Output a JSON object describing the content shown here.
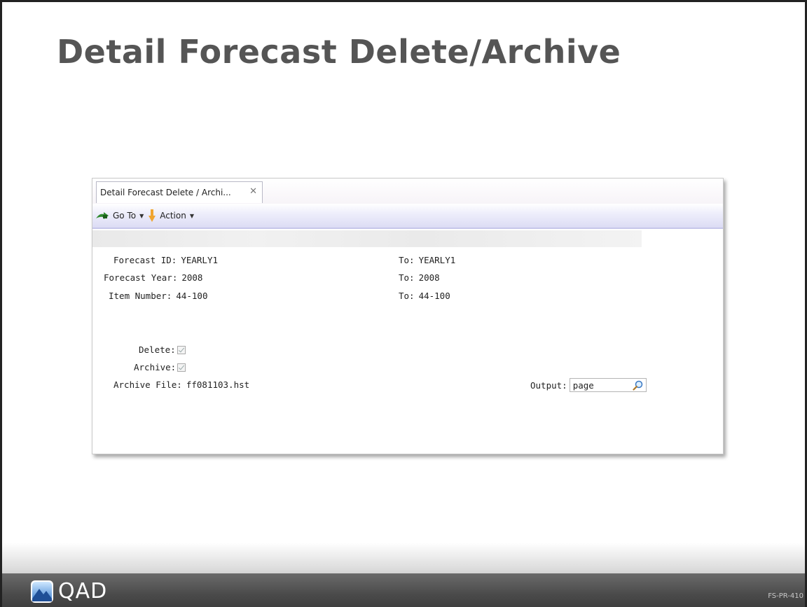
{
  "slide": {
    "title": "Detail Forecast Delete/Archive",
    "logo_text": "QAD",
    "code": "FS-PR-410"
  },
  "window": {
    "tab_label": "Detail Forecast Delete / Archi...",
    "toolbar": {
      "goto_label": "Go To",
      "action_label": "Action"
    }
  },
  "form": {
    "forecast_id": {
      "label": "Forecast ID:",
      "value": "YEARLY1",
      "to_label": "To:",
      "to_value": "YEARLY1"
    },
    "forecast_year": {
      "label": "Forecast Year:",
      "value": "2008",
      "to_label": "To:",
      "to_value": "2008"
    },
    "item_number": {
      "label": "Item Number:",
      "value": "44-100",
      "to_label": "To:",
      "to_value": "44-100"
    },
    "delete": {
      "label": "Delete:",
      "checked": true
    },
    "archive": {
      "label": "Archive:",
      "checked": true
    },
    "archive_file": {
      "label": "Archive File:",
      "value": "ff081103.hst"
    },
    "output": {
      "label": "Output:",
      "value": "page"
    }
  }
}
